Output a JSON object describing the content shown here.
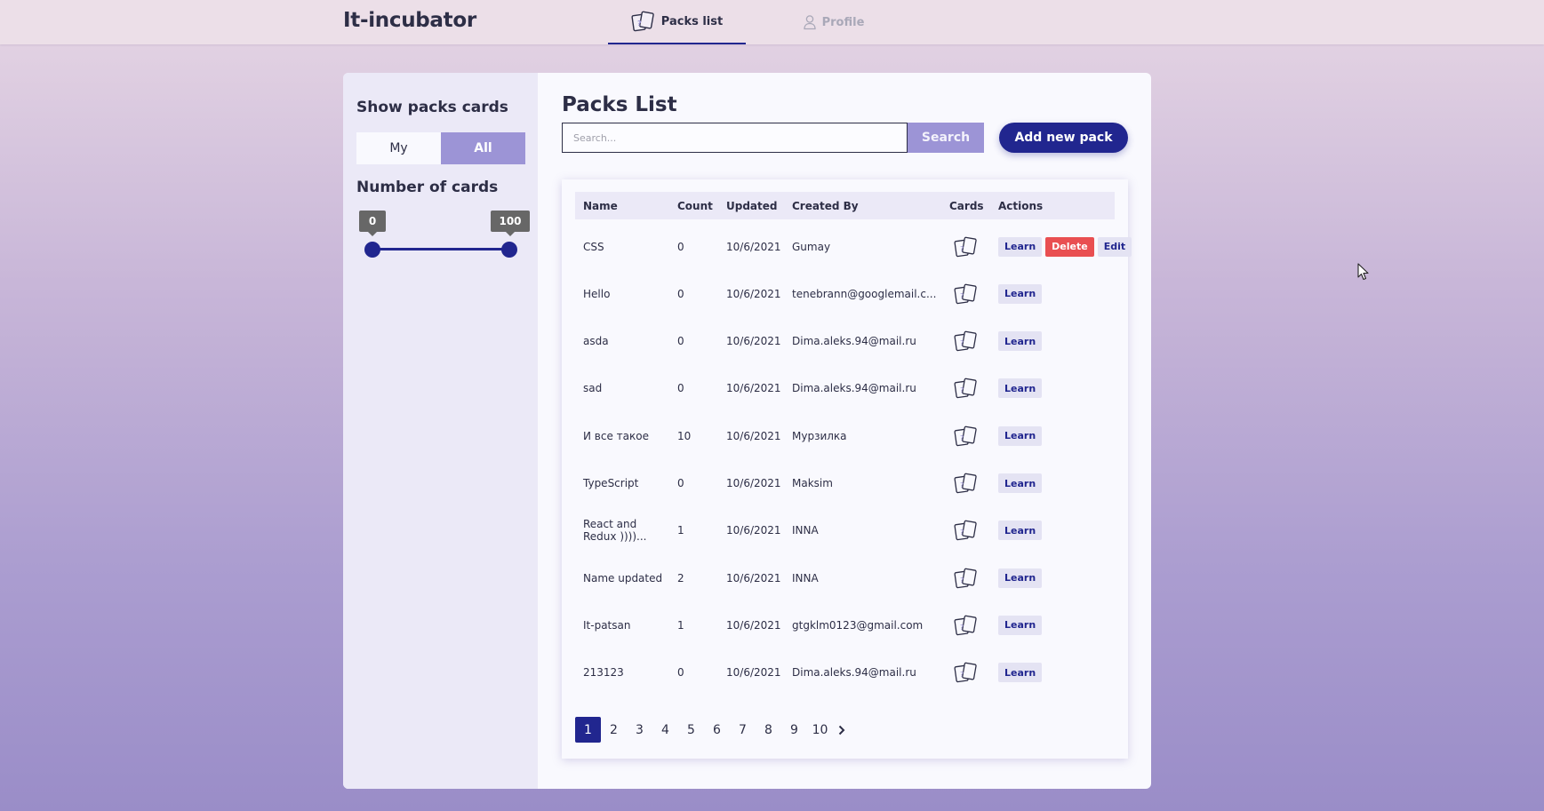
{
  "header": {
    "logo": "It-incubator",
    "tabs": [
      {
        "label": "Packs list",
        "icon": "cards-icon",
        "active": true
      },
      {
        "label": "Profile",
        "icon": "user-icon",
        "active": false
      }
    ]
  },
  "sidebar": {
    "title": "Show packs cards",
    "toggle": {
      "my_label": "My",
      "all_label": "All",
      "selected": "All"
    },
    "range_title": "Number of cards",
    "range": {
      "min": "0",
      "max": "100",
      "min_value": 0,
      "max_value": 100
    }
  },
  "main": {
    "title": "Packs List",
    "search": {
      "placeholder": "Search...",
      "value": "",
      "button_label": "Search"
    },
    "add_button_label": "Add new pack",
    "columns": [
      "Name",
      "Count",
      "Updated",
      "Created By",
      "Cards",
      "Actions"
    ],
    "rows": [
      {
        "name": "CSS",
        "count": "0",
        "updated": "10/6/2021",
        "created_by": "Gumay",
        "actions": [
          "Learn",
          "Delete",
          "Edit"
        ]
      },
      {
        "name": "Hello",
        "count": "0",
        "updated": "10/6/2021",
        "created_by": "tenebrann@googlemail.c...",
        "actions": [
          "Learn"
        ]
      },
      {
        "name": "asda",
        "count": "0",
        "updated": "10/6/2021",
        "created_by": "Dima.aleks.94@mail.ru",
        "actions": [
          "Learn"
        ]
      },
      {
        "name": "sad",
        "count": "0",
        "updated": "10/6/2021",
        "created_by": "Dima.aleks.94@mail.ru",
        "actions": [
          "Learn"
        ]
      },
      {
        "name": "И все такое",
        "count": "10",
        "updated": "10/6/2021",
        "created_by": "Мурзилка",
        "actions": [
          "Learn"
        ]
      },
      {
        "name": "TypeScript",
        "count": "0",
        "updated": "10/6/2021",
        "created_by": "Maksim",
        "actions": [
          "Learn"
        ]
      },
      {
        "name": "React and Redux ))))...",
        "count": "1",
        "updated": "10/6/2021",
        "created_by": "INNA",
        "actions": [
          "Learn"
        ]
      },
      {
        "name": "Name updated",
        "count": "2",
        "updated": "10/6/2021",
        "created_by": "INNA",
        "actions": [
          "Learn"
        ]
      },
      {
        "name": "It-patsan",
        "count": "1",
        "updated": "10/6/2021",
        "created_by": "gtgklm0123@gmail.com",
        "actions": [
          "Learn"
        ]
      },
      {
        "name": "213123",
        "count": "0",
        "updated": "10/6/2021",
        "created_by": "Dima.aleks.94@mail.ru",
        "actions": [
          "Learn"
        ]
      }
    ],
    "pagination": {
      "pages": [
        "1",
        "2",
        "3",
        "4",
        "5",
        "6",
        "7",
        "8",
        "9",
        "10"
      ],
      "current": "1",
      "next_icon": "chevron-right-icon"
    }
  },
  "colors": {
    "accent": "#21268f",
    "toggle_selected": "#9c94d6",
    "delete": "#e94f51",
    "text": "#2d2e46"
  }
}
